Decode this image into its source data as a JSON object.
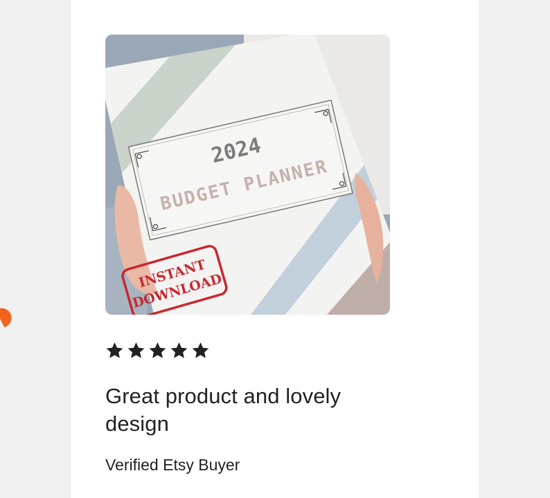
{
  "review": {
    "rating": 5,
    "rating_max": 5,
    "title": "Great product and lovely design",
    "reviewer": "Verified Etsy Buyer"
  },
  "product_image": {
    "year": "2024",
    "heading": "BUDGET PLANNER",
    "stamp_line1": "INSTANT",
    "stamp_line2": "DOWNLOAD"
  },
  "colors": {
    "page_bg": "#f1f1f1",
    "card_bg": "#ffffff",
    "star": "#222222",
    "text": "#222222",
    "accent": "#f1641e",
    "stripe_sage": "#c9d3ca",
    "stripe_blue": "#c2d0dc",
    "stripe_mauve": "#bfaea8",
    "stamp_red": "#c8282e"
  },
  "icons": {
    "star": "star-icon",
    "corner": "corner-ornament-icon"
  }
}
